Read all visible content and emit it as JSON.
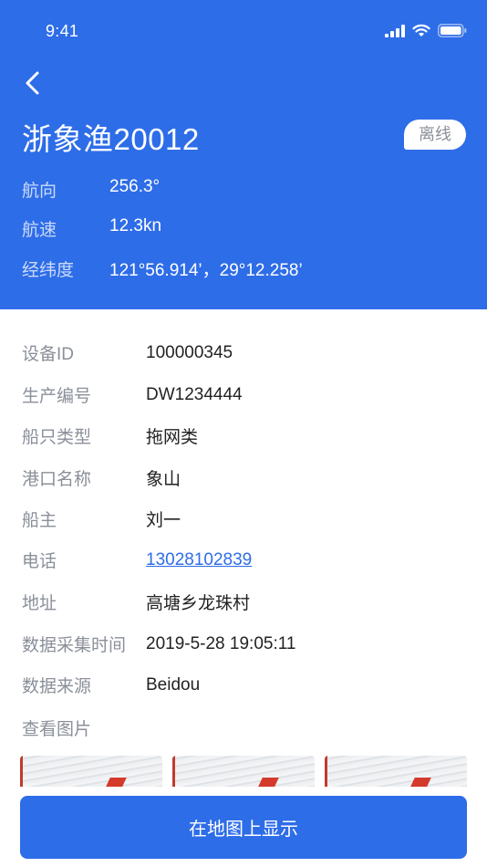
{
  "status_bar": {
    "time": "9:41"
  },
  "header": {
    "title": "浙象渔20012",
    "status_badge": "离线",
    "rows": [
      {
        "label": "航向",
        "value": "256.3°"
      },
      {
        "label": "航速",
        "value": "12.3kn"
      },
      {
        "label": "经纬度",
        "value": "121°56.914’，29°12.258’"
      }
    ]
  },
  "details": [
    {
      "label": "设备ID",
      "value": "100000345"
    },
    {
      "label": "生产编号",
      "value": "DW1234444"
    },
    {
      "label": "船只类型",
      "value": "拖网类"
    },
    {
      "label": "港口名称",
      "value": "象山"
    },
    {
      "label": "船主",
      "value": "刘一"
    },
    {
      "label": "电话",
      "value": "13028102839"
    },
    {
      "label": "地址",
      "value": "高塘乡龙珠村"
    },
    {
      "label": "数据采集时间",
      "value": "2019-5-28 19:05:11"
    },
    {
      "label": "数据来源",
      "value": "Beidou"
    }
  ],
  "photos": {
    "label": "查看图片",
    "count": 3
  },
  "footer": {
    "button_label": "在地图上显示"
  },
  "colors": {
    "primary": "#2e6de8",
    "label_gray": "#8a8f99",
    "text_dark": "#222222"
  }
}
